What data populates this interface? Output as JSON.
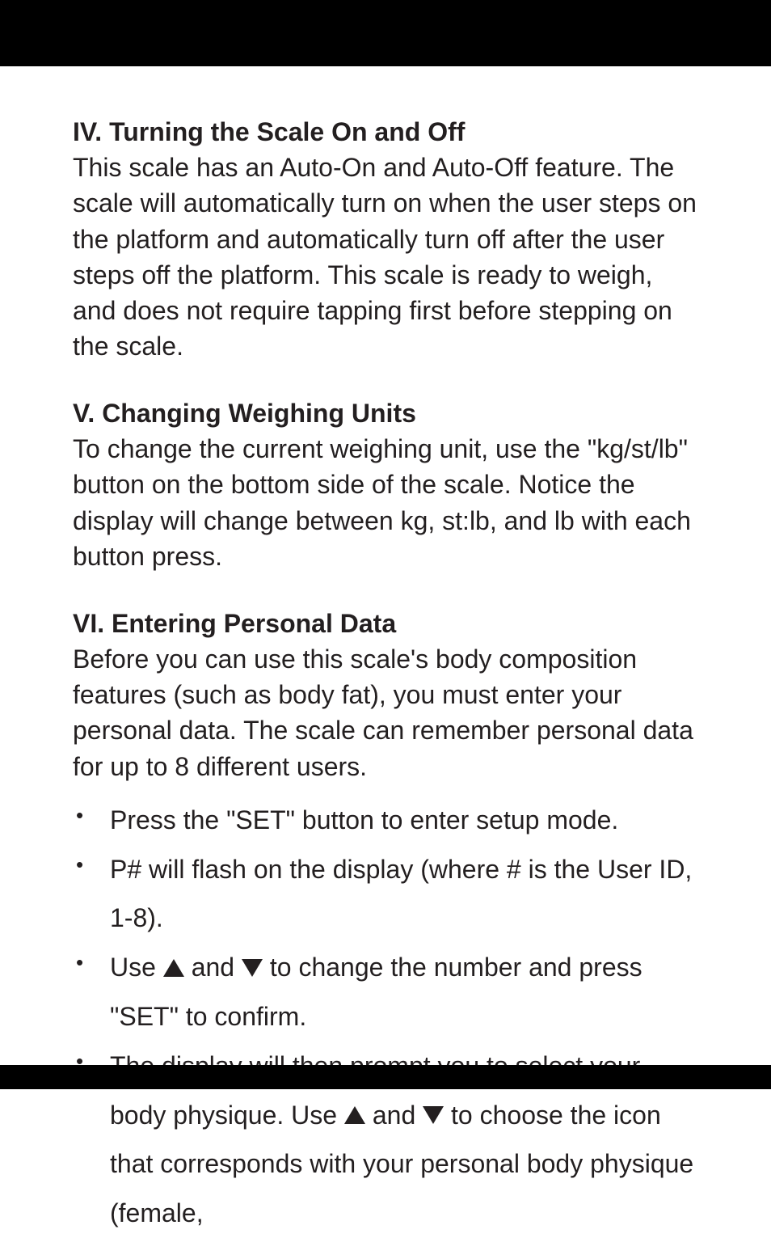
{
  "sections": {
    "s4": {
      "heading": "IV. Turning the Scale On and Off",
      "body": "This scale has an Auto-On and Auto-Off feature. The scale will automatically turn on when the user steps on the platform and automatically turn off after the user steps off the platform. This scale is ready to weigh, and does not require tapping first before stepping on the scale."
    },
    "s5": {
      "heading": "V. Changing Weighing Units",
      "body": "To change the current weighing unit, use the \"kg/st/lb\" button on the bottom side of the scale. Notice the display will change between kg, st:lb, and lb with each button press."
    },
    "s6": {
      "heading": "VI. Entering Personal Data",
      "body": "Before you can use this scale's body composition features (such as body fat), you must enter your personal data. The scale can remember personal data for up to 8 different users.",
      "bullets": {
        "b1": "Press the \"SET\" button to enter setup mode.",
        "b2": "P# will flash on the display (where # is the User ID, 1-8).",
        "b3_pre": "Use ",
        "b3_mid": " and ",
        "b3_post": " to change the number and press \"SET\" to confirm.",
        "b4_pre": "The display will then prompt you to select your body physique. Use ",
        "b4_mid": " and ",
        "b4_post": " to choose the icon that corresponds with your personal body physique (female,"
      }
    }
  }
}
